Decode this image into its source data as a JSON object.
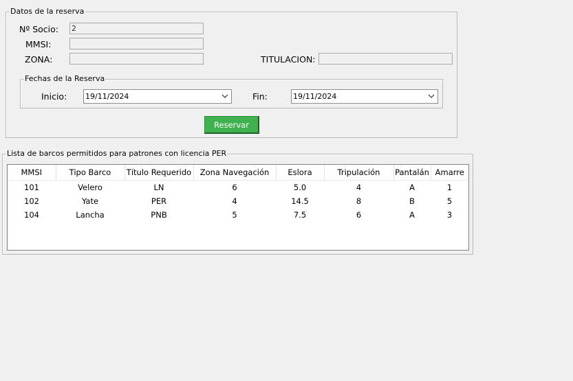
{
  "reservation": {
    "legend": "Datos de la reserva",
    "socio_label": "Nº Socio:",
    "socio_value": "2",
    "mmsi_label": "MMSI:",
    "mmsi_value": "",
    "zona_label": "ZONA:",
    "zona_value": "",
    "titulacion_label": "TITULACION:",
    "titulacion_value": "",
    "dates": {
      "legend": "Fechas de la Reserva",
      "inicio_label": "Inicio:",
      "inicio_value": "19/11/2024",
      "fin_label": "Fin:",
      "fin_value": "19/11/2024"
    },
    "reserve_button": "Reservar",
    "reserve_button_color": "#3fb24f"
  },
  "boats": {
    "legend": "Lista de barcos permitidos para patrones con licencia PER",
    "columns": [
      "MMSI",
      "Tipo Barco",
      "Título Requerido",
      "Zona Navegación",
      "Eslora",
      "Tripulación",
      "Pantalán",
      "Amarre"
    ],
    "rows": [
      [
        "101",
        "Velero",
        "LN",
        "6",
        "5.0",
        "4",
        "A",
        "1"
      ],
      [
        "102",
        "Yate",
        "PER",
        "4",
        "14.5",
        "8",
        "B",
        "5"
      ],
      [
        "104",
        "Lancha",
        "PNB",
        "5",
        "7.5",
        "6",
        "A",
        "3"
      ]
    ]
  }
}
